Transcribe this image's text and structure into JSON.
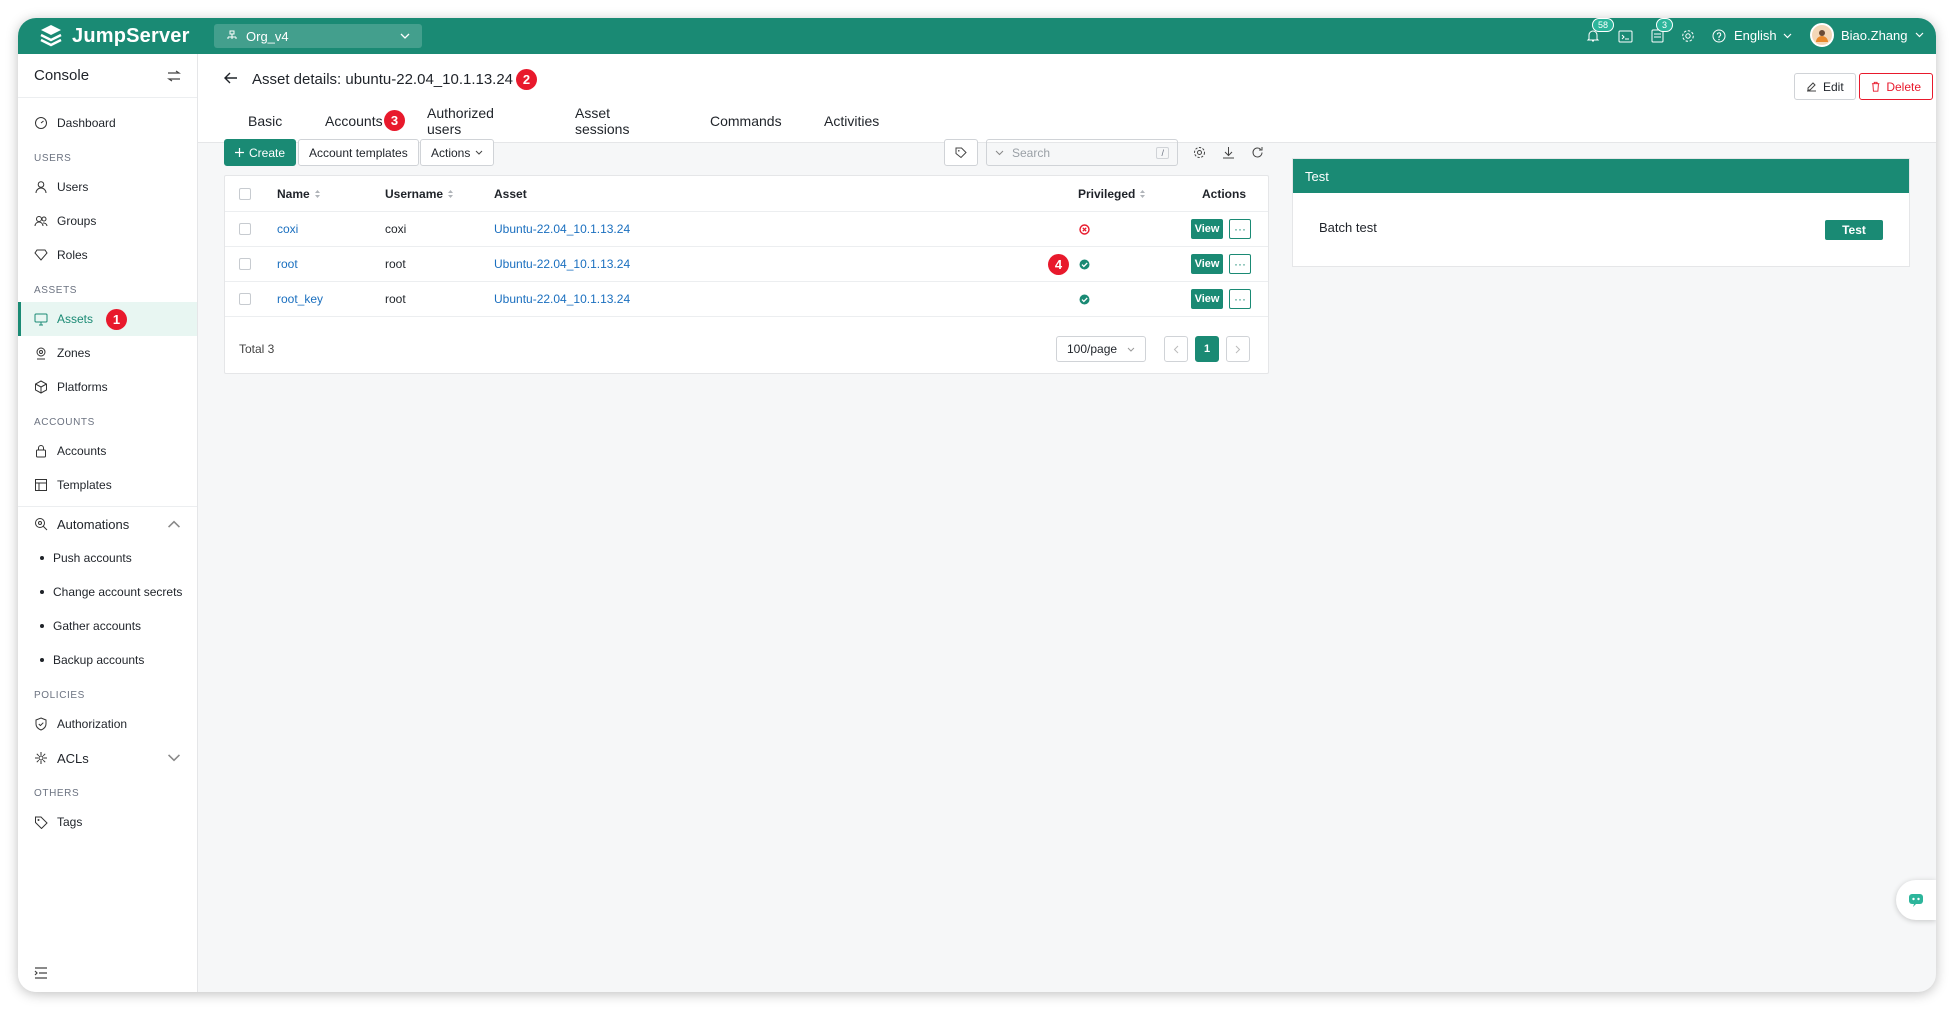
{
  "app": {
    "logo": "JumpServer",
    "org": "Org_v4",
    "language": "English",
    "user": "Biao.Zhang"
  },
  "topbar": {
    "notify_count": "58",
    "tickets_count": "3"
  },
  "sidebar": {
    "title": "Console",
    "dashboard": "Dashboard",
    "sec_users": "USERS",
    "users": "Users",
    "groups": "Groups",
    "roles": "Roles",
    "sec_assets": "ASSETS",
    "assets": "Assets",
    "zones": "Zones",
    "platforms": "Platforms",
    "sec_accounts": "ACCOUNTS",
    "accounts": "Accounts",
    "templates": "Templates",
    "automations": "Automations",
    "auto_items": [
      "Push accounts",
      "Change account secrets",
      "Gather accounts",
      "Backup accounts"
    ],
    "sec_policies": "POLICIES",
    "authorization": "Authorization",
    "acls": "ACLs",
    "sec_others": "OTHERS",
    "tags": "Tags"
  },
  "markers": [
    "1",
    "2",
    "3",
    "4"
  ],
  "header": {
    "title": "Asset details: ubuntu-22.04_10.1.13.24",
    "edit": "Edit",
    "delete": "Delete",
    "tabs": [
      "Basic",
      "Accounts",
      "Authorized users",
      "Asset sessions",
      "Commands",
      "Activities"
    ]
  },
  "toolbar": {
    "create": "Create",
    "templates": "Account templates",
    "actions": "Actions",
    "search_placeholder": "Search",
    "search_hint": "/"
  },
  "table": {
    "columns": [
      "Name",
      "Username",
      "Asset",
      "Privileged",
      "Actions"
    ],
    "rows": [
      {
        "name": "coxi",
        "username": "coxi",
        "asset": "Ubuntu-22.04_10.1.13.24",
        "privileged": false
      },
      {
        "name": "root",
        "username": "root",
        "asset": "Ubuntu-22.04_10.1.13.24",
        "privileged": true
      },
      {
        "name": "root_key",
        "username": "root",
        "asset": "Ubuntu-22.04_10.1.13.24",
        "privileged": true
      }
    ],
    "view_label": "View",
    "more_label": "···",
    "total": "Total 3",
    "page_size": "100/page",
    "page": "1"
  },
  "test_panel": {
    "title": "Test",
    "row_label": "Batch test",
    "button": "Test"
  },
  "colors": {
    "brand": "#1a8a74",
    "marker": "#e8192c",
    "link": "#1a6fbf"
  }
}
